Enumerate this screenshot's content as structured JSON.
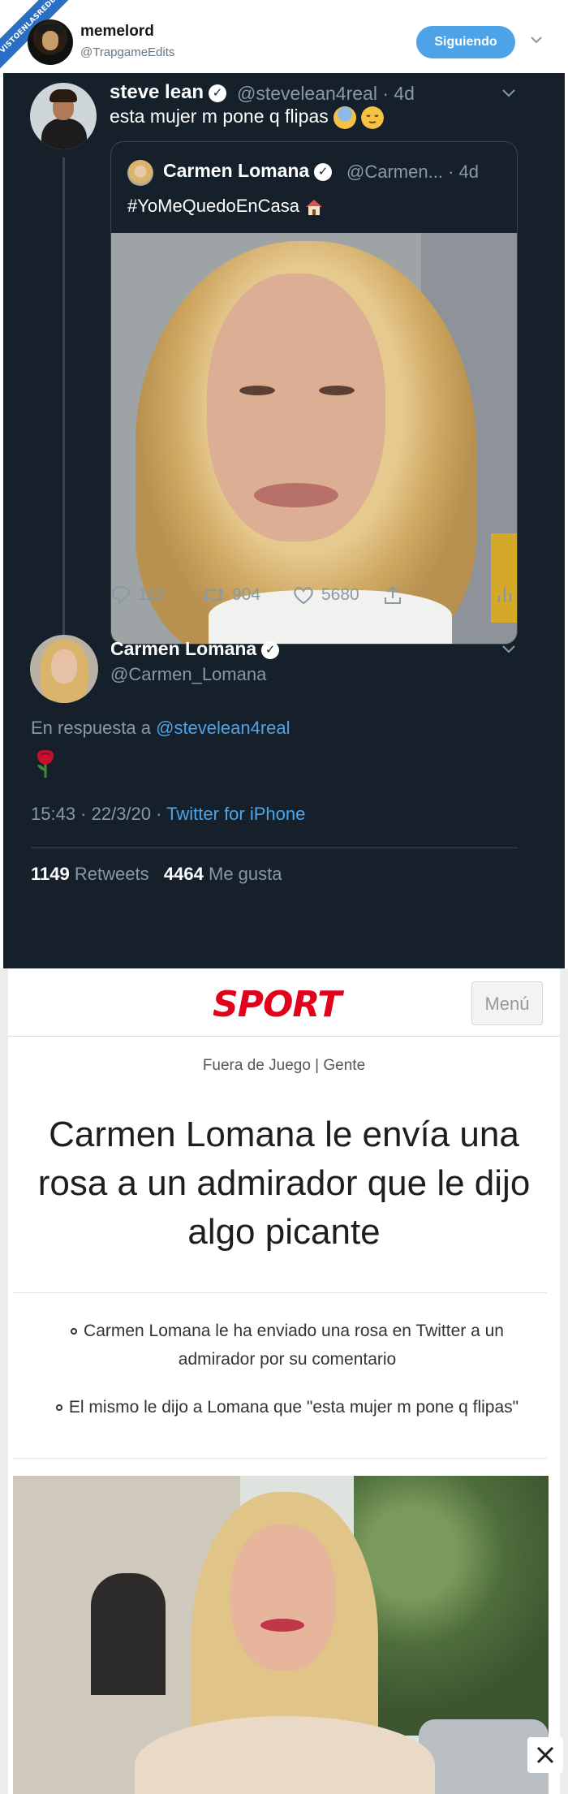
{
  "watermark": {
    "line1": "VISTOENLASREDES",
    "line2": ".com"
  },
  "header": {
    "name": "memelord",
    "handle": "@TrapgameEdits",
    "follow_label": "Siguiendo"
  },
  "tweet": {
    "name": "steve lean",
    "handle": "@stevelean4real · 4d",
    "text": "esta mujer m pone q flipas",
    "quote": {
      "name": "Carmen Lomana",
      "handle": "@Carmen... · 4d",
      "text": "#YoMeQuedoEnCasa"
    },
    "actions": {
      "replies": "112",
      "retweets": "904",
      "likes": "5680"
    }
  },
  "reply": {
    "name": "Carmen Lomana",
    "handle": "@Carmen_Lomana",
    "reply_prefix": "En respuesta a",
    "reply_handle": "@stevelean4real",
    "time": "15:43 · 22/3/20 ·",
    "client": "Twitter for iPhone",
    "retweets_count": "1149",
    "retweets_label": "Retweets",
    "likes_count": "4464",
    "likes_label": "Me gusta"
  },
  "article": {
    "logo": "SPORT",
    "menu_label": "Menú",
    "section": "Fuera de Juego | Gente",
    "headline": "Carmen Lomana le envía una rosa a un admirador que le dijo algo picante",
    "bullets": [
      "Carmen Lomana le ha enviado una rosa en Twitter a un admirador por su comentario",
      "El mismo le dijo a Lomana que \"esta mujer m pone q flipas\""
    ]
  },
  "colors": {
    "twitter_dark_bg": "#15202b",
    "twitter_blue": "#4ea4e8",
    "sport_red": "#e2001a"
  }
}
